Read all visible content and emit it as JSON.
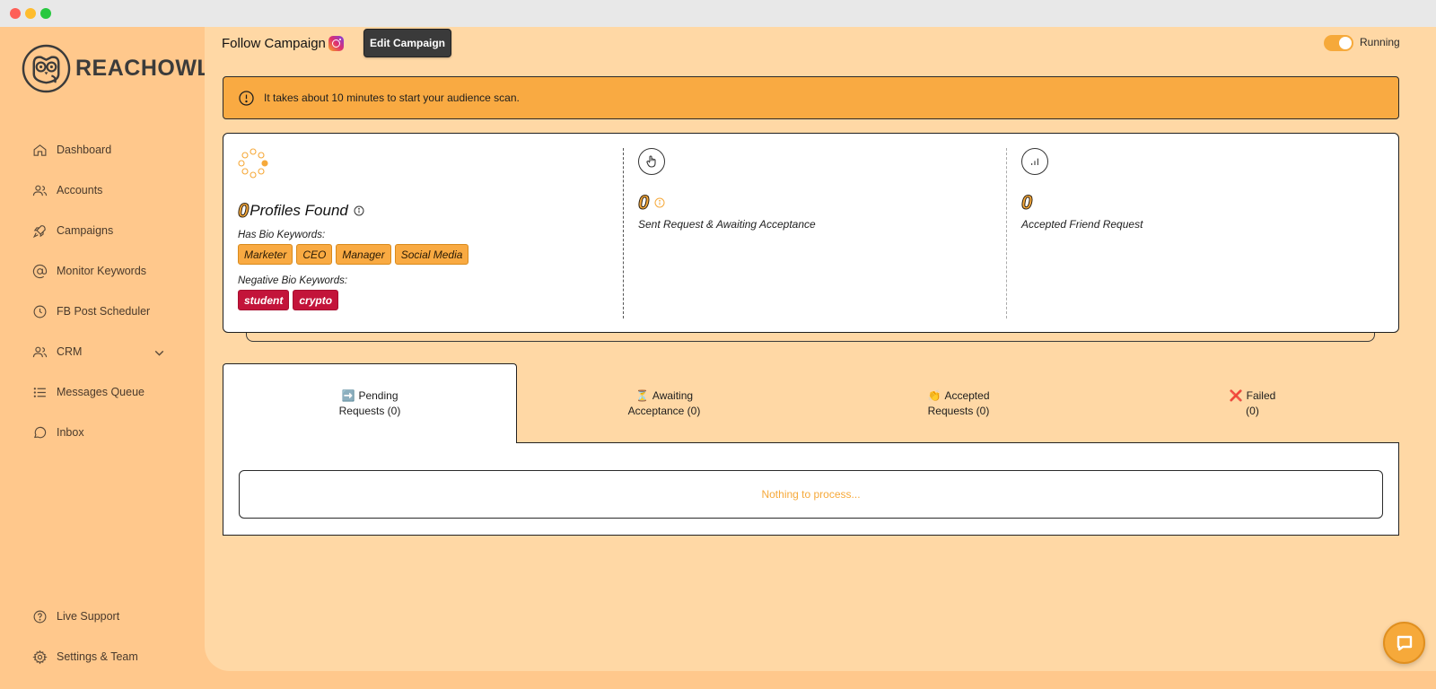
{
  "app": {
    "name": "REACHOWL"
  },
  "sidebar": {
    "items": [
      {
        "label": "Dashboard",
        "icon": "home-icon"
      },
      {
        "label": "Accounts",
        "icon": "users-icon"
      },
      {
        "label": "Campaigns",
        "icon": "rocket-icon"
      },
      {
        "label": "Monitor Keywords",
        "icon": "at-sign-icon"
      },
      {
        "label": "FB Post Scheduler",
        "icon": "clock-icon"
      },
      {
        "label": "CRM",
        "icon": "users-icon"
      },
      {
        "label": "Messages Queue",
        "icon": "list-icon"
      },
      {
        "label": "Inbox",
        "icon": "chat-icon"
      }
    ],
    "bottom_items": [
      {
        "label": "Live Support",
        "icon": "help-circle-icon"
      },
      {
        "label": "Settings & Team",
        "icon": "gear-icon"
      }
    ]
  },
  "header": {
    "title": "Follow Campaign",
    "edit_label": "Edit Campaign",
    "status_label": "Running"
  },
  "alert": {
    "text": "It takes about 10 minutes to start your audience scan."
  },
  "stats": {
    "profiles_found": {
      "value": "0",
      "label": "Profiles Found"
    },
    "bio_keywords_label": "Has Bio Keywords:",
    "bio_keywords": [
      "Marketer",
      "CEO",
      "Manager",
      "Social Media"
    ],
    "negative_keywords_label": "Negative Bio Keywords:",
    "negative_keywords": [
      "student",
      "crypto"
    ],
    "sent": {
      "value": "0",
      "label": "Sent Request & Awaiting Acceptance"
    },
    "accepted": {
      "value": "0",
      "label": "Accepted Friend Request"
    }
  },
  "tabs": [
    {
      "icon": "➡️",
      "line1": "Pending",
      "line2": "Requests (0)"
    },
    {
      "icon": "⏳",
      "line1": "Awaiting",
      "line2": "Acceptance (0)"
    },
    {
      "icon": "👏",
      "line1": "Accepted",
      "line2": "Requests (0)"
    },
    {
      "icon": "❌",
      "line1": "Failed",
      "line2": "(0)"
    }
  ],
  "empty_text": "Nothing to process...",
  "colors": {
    "accent": "#f6a93a",
    "sidebar_bg": "#ffc88c",
    "main_bg": "#ffd8a5",
    "negative": "#c3143a"
  }
}
